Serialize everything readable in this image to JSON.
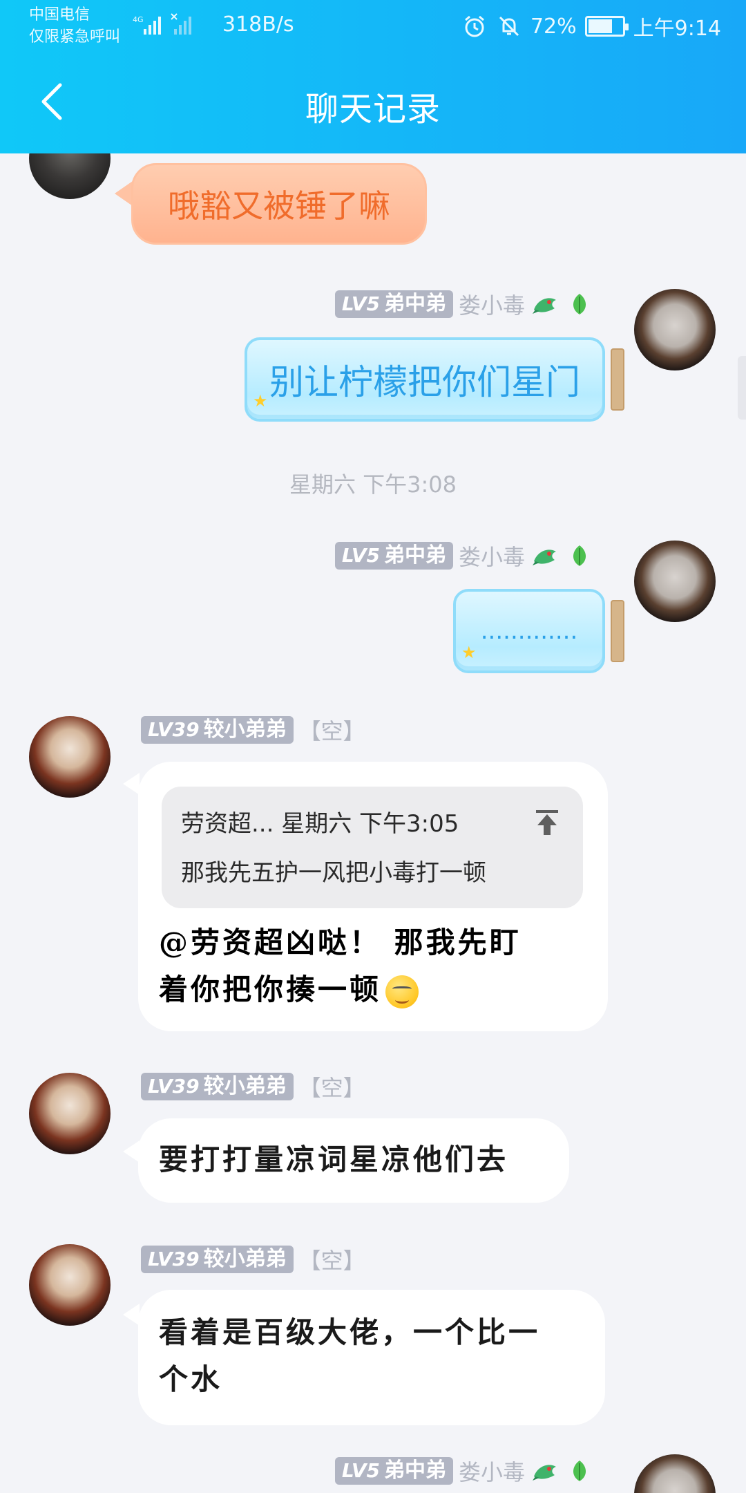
{
  "status_bar": {
    "carrier_line1": "中国电信",
    "carrier_line2": "仅限紧急呼叫",
    "network": "4G",
    "speed": "318B/s",
    "battery": "72%",
    "battery_level": 0.72,
    "time": "上午9:14"
  },
  "nav": {
    "title": "聊天记录"
  },
  "messages": {
    "m0": {
      "text": "哦豁又被锤了嘛"
    },
    "m1": {
      "level": "LV5",
      "group_title": "弟中弟",
      "nick": "娄小毒",
      "text": "别让柠檬把你们星门"
    },
    "timestamp": "星期六 下午3:08",
    "m2": {
      "level": "LV5",
      "group_title": "弟中弟",
      "nick": "娄小毒",
      "text": "............."
    },
    "m3": {
      "level": "LV39",
      "group_title": "较小弟弟",
      "nick": "【空】",
      "quote_header": "劳资超... 星期六 下午3:05",
      "quote_body": "那我先五护一风把小毒打一顿",
      "line1": "@劳资超凶哒！ 那我先盯",
      "line2": "着你把你揍一顿"
    },
    "m4": {
      "level": "LV39",
      "group_title": "较小弟弟",
      "nick": "【空】",
      "text": "要打打量凉词星凉他们去"
    },
    "m5": {
      "level": "LV39",
      "group_title": "较小弟弟",
      "nick": "【空】",
      "line1": "看着是百级大佬，一个比一",
      "line2": "个水"
    },
    "m6": {
      "level": "LV5",
      "group_title": "弟中弟",
      "nick": "娄小毒"
    }
  },
  "colors": {
    "header_start": "#10c8f8",
    "header_end": "#18a8f8",
    "bottle_text": "#2aa0e8",
    "orange_text": "#f06c2b",
    "level_badge": "#b1b5c3",
    "background": "#f3f4f8"
  },
  "icons": [
    "back-arrow-icon",
    "alarm-icon",
    "mute-bell-icon",
    "battery-icon",
    "dragon-badge-icon",
    "leaf-badge-icon",
    "pin-top-icon",
    "smile-emoji-icon"
  ]
}
